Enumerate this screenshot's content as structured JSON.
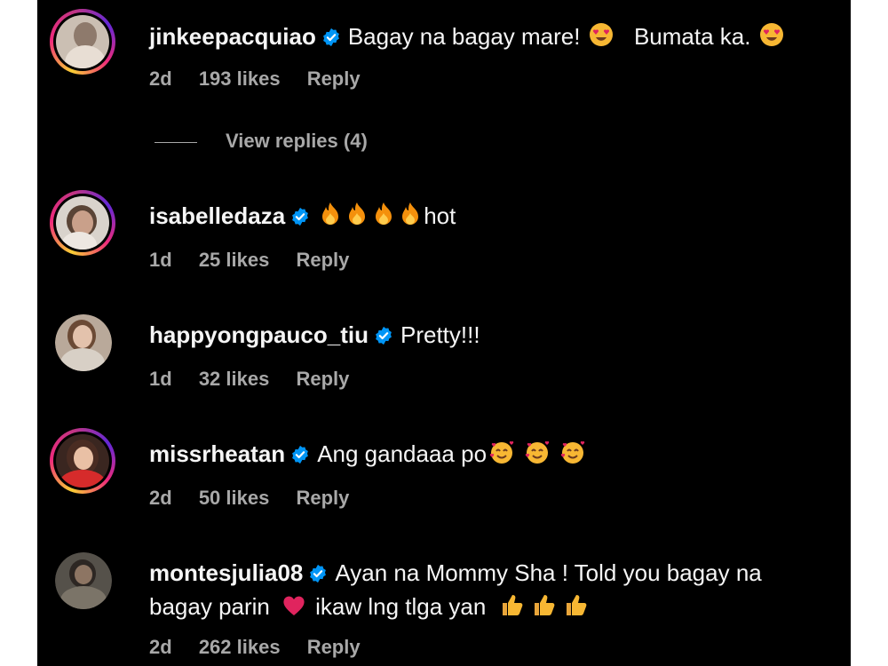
{
  "comments": [
    {
      "username": "jinkeepacquiao",
      "text_parts": [
        "Bagay na bagay mare!",
        "Bumata ka."
      ],
      "time": "2d",
      "likes": "193 likes",
      "reply": "Reply",
      "view_replies": "View replies (4)"
    },
    {
      "username": "isabelledaza",
      "text": "hot",
      "time": "1d",
      "likes": "25 likes",
      "reply": "Reply"
    },
    {
      "username": "happyongpauco_tiu",
      "text": "Pretty!!!",
      "time": "1d",
      "likes": "32 likes",
      "reply": "Reply"
    },
    {
      "username": "missrheatan",
      "text": "Ang gandaaa po",
      "time": "2d",
      "likes": "50 likes",
      "reply": "Reply"
    },
    {
      "username": "montesjulia08",
      "text_line1": "Ayan na Mommy Sha ! Told you bagay na",
      "text_line2a": "bagay parin",
      "text_line2b": "ikaw lng tlga yan",
      "time": "2d",
      "likes": "262 likes",
      "reply": "Reply"
    }
  ],
  "colors": {
    "background": "#000000",
    "primary_text": "#f5f5f5",
    "secondary_text": "#a8a8a8",
    "verified_badge": "#0095f6"
  }
}
